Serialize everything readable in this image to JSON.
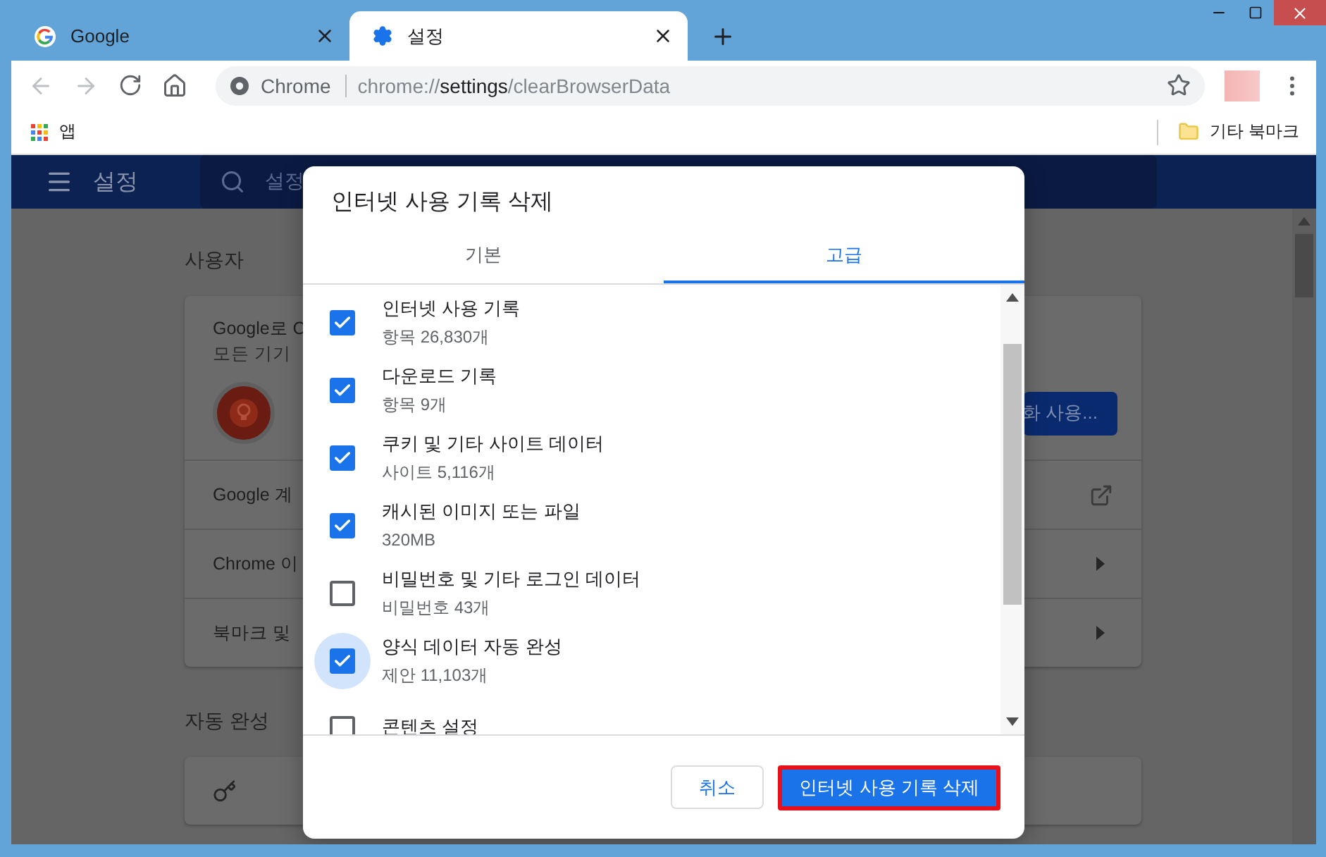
{
  "tabs": [
    {
      "kind": "google",
      "title": "Google",
      "selected": false
    },
    {
      "kind": "settings",
      "title": "설정",
      "selected": true
    }
  ],
  "toolbar": {
    "origin": "Chrome",
    "url": {
      "scheme": "chrome://",
      "host": "settings",
      "path": "/clearBrowserData"
    }
  },
  "bookmarks": {
    "apps": "앱",
    "other": "기타 북마크"
  },
  "settings_page": {
    "title": "설정",
    "search_placeholder": "설정",
    "section": "사용자",
    "sync_title": "Google로 C",
    "sync_desc": "모든 기기",
    "sync_button": "화 사용...",
    "rows": [
      {
        "label": "Google 계",
        "kind": "external"
      },
      {
        "label": "Chrome 이",
        "kind": "arrow"
      },
      {
        "label": "북마크 및",
        "kind": "arrow"
      }
    ],
    "section2": "자동 완성"
  },
  "dialog": {
    "title": "인터넷 사용 기록 삭제",
    "tabs": [
      {
        "label": "기본",
        "selected": false
      },
      {
        "label": "고급",
        "selected": true
      }
    ],
    "items": [
      {
        "label": "인터넷 사용 기록",
        "detail": "항목 26,830개",
        "checked": true,
        "focused": false
      },
      {
        "label": "다운로드 기록",
        "detail": "항목 9개",
        "checked": true,
        "focused": false
      },
      {
        "label": "쿠키 및 기타 사이트 데이터",
        "detail": "사이트 5,116개",
        "checked": true,
        "focused": false
      },
      {
        "label": "캐시된 이미지 또는 파일",
        "detail": "320MB",
        "checked": true,
        "focused": false
      },
      {
        "label": "비밀번호 및 기타 로그인 데이터",
        "detail": "비밀번호 43개",
        "checked": false,
        "focused": false
      },
      {
        "label": "양식 데이터 자동 완성",
        "detail": "제안 11,103개",
        "checked": true,
        "focused": true
      },
      {
        "label": "콘텐츠 설정",
        "checked": false,
        "focused": false
      }
    ],
    "cancel": "취소",
    "confirm": {
      "label": "인터넷 사용 기록 삭제",
      "highlighted": true
    }
  }
}
